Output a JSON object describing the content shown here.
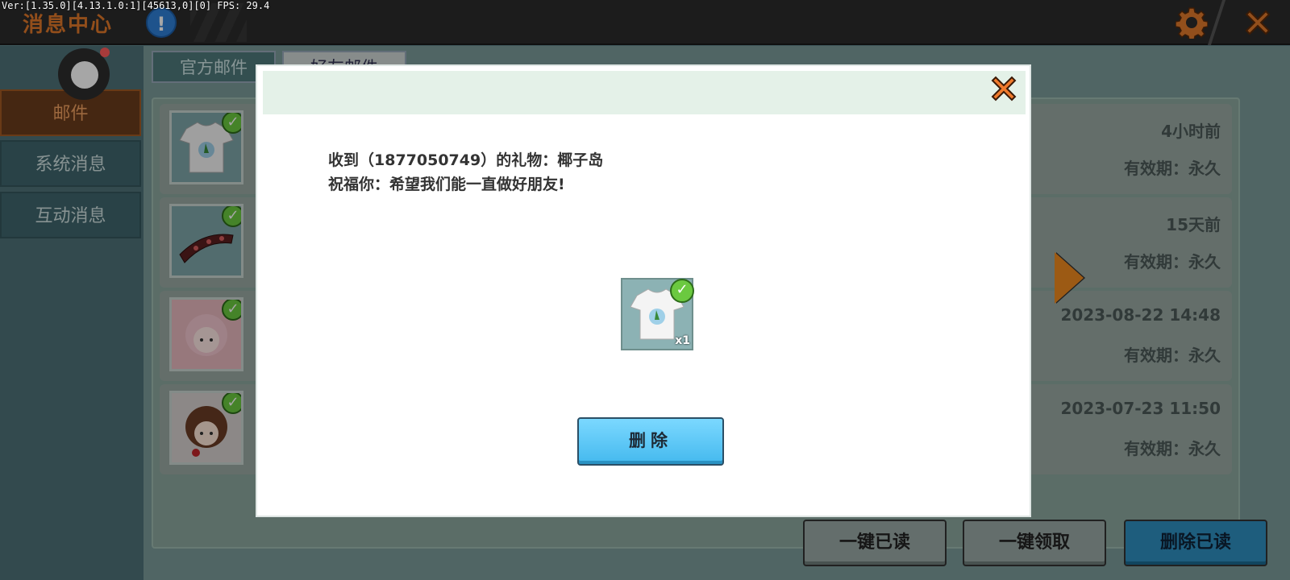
{
  "debug": {
    "text": "Ver:[1.35.0][4.13.1.0:1][45613,0][0] FPS: 29.4"
  },
  "header": {
    "title": "消息中心",
    "info_icon": "!"
  },
  "sidebar": {
    "items": [
      {
        "label": "邮件",
        "active": true
      },
      {
        "label": "系统消息",
        "active": false
      },
      {
        "label": "互动消息",
        "active": false
      }
    ]
  },
  "tabs": [
    {
      "label": "官方邮件"
    },
    {
      "label": "好友邮件"
    }
  ],
  "mails": [
    {
      "time": "4小时前",
      "validity": "有效期：永久",
      "thumb": "tshirt-icon"
    },
    {
      "time": "15天前",
      "validity": "有效期：永久",
      "thumb": "belt-icon"
    },
    {
      "time": "2023-08-22 14:48",
      "validity": "有效期：永久",
      "thumb": "pink-girl-avatar"
    },
    {
      "time": "2023-07-23 11:50",
      "validity": "有效期：永久",
      "thumb": "brown-girl-avatar"
    }
  ],
  "actions": {
    "read_all": "一键已读",
    "claim_all": "一键领取",
    "delete_read": "删除已读"
  },
  "modal": {
    "line1": "收到（1877050749）的礼物：椰子岛",
    "line2": "祝福你：希望我们能一直做好朋友!",
    "item_qty": "x1",
    "delete_label": "删除"
  },
  "colors": {
    "accent_orange": "#e0782a",
    "check_green": "#6bc940",
    "blue_button": "#44b9ee"
  }
}
